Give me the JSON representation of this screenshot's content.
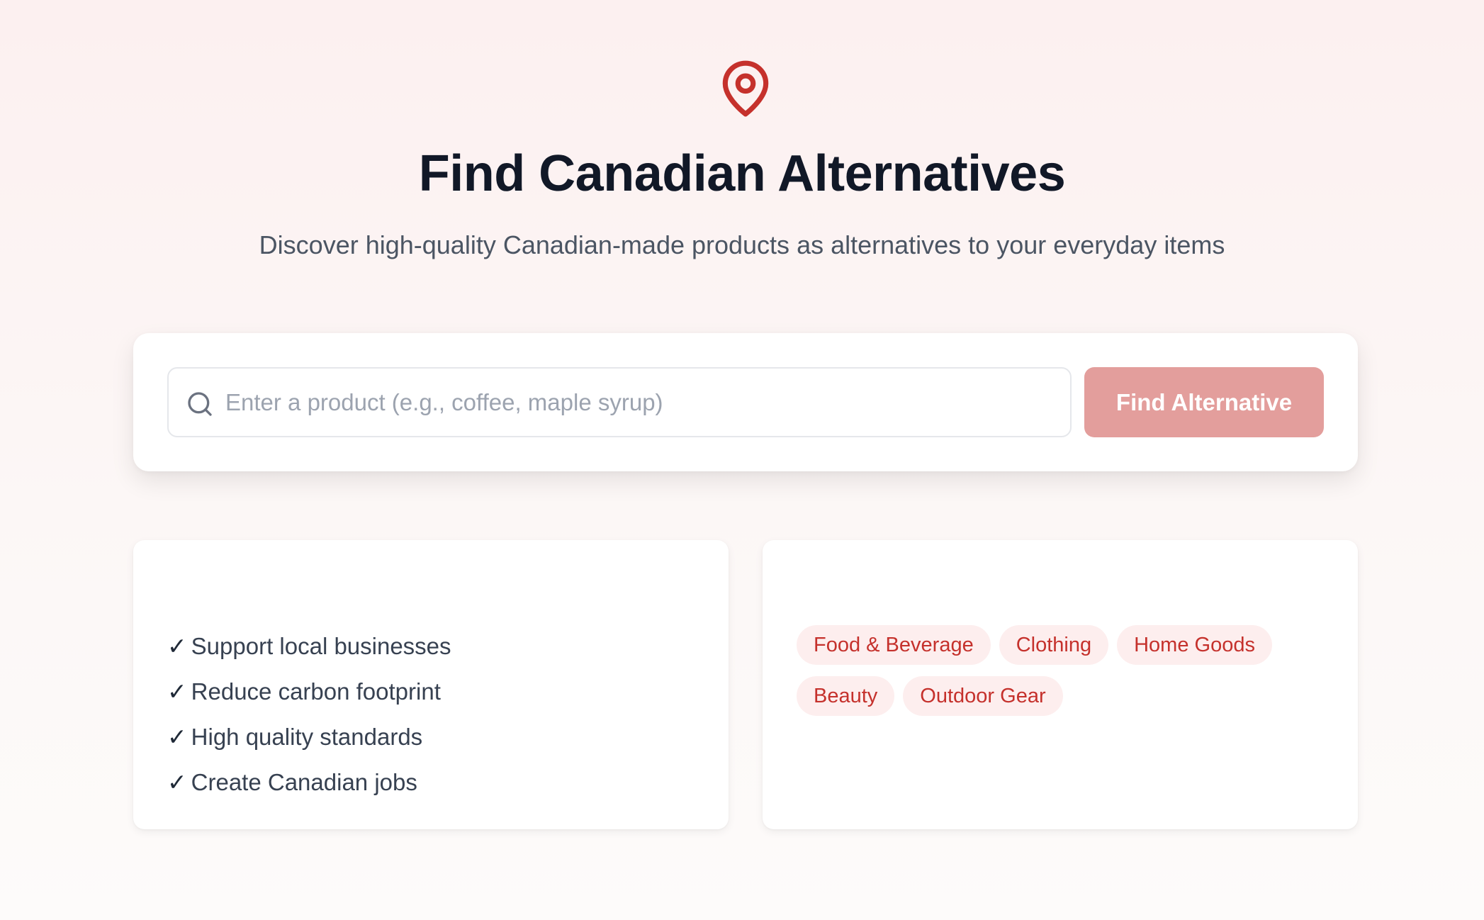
{
  "hero": {
    "icon": "map-pin-icon",
    "title": "Find Canadian Alternatives",
    "subtitle": "Discover high-quality Canadian-made products as alternatives to your everyday items"
  },
  "search": {
    "icon": "search-icon",
    "value": "",
    "placeholder": "Enter a product (e.g., coffee, maple syrup)",
    "button_label": "Find Alternative"
  },
  "benefits": {
    "check_glyph": "✓",
    "items": [
      "Support local businesses",
      "Reduce carbon footprint",
      "High quality standards",
      "Create Canadian jobs"
    ]
  },
  "categories": {
    "items": [
      "Food & Beverage",
      "Clothing",
      "Home Goods",
      "Beauty",
      "Outdoor Gear"
    ]
  },
  "colors": {
    "accent": "#c5312c",
    "button_bg": "#e39e9c",
    "chip_bg": "#fdeeee",
    "title": "#111827",
    "subtitle": "#4b5563"
  }
}
